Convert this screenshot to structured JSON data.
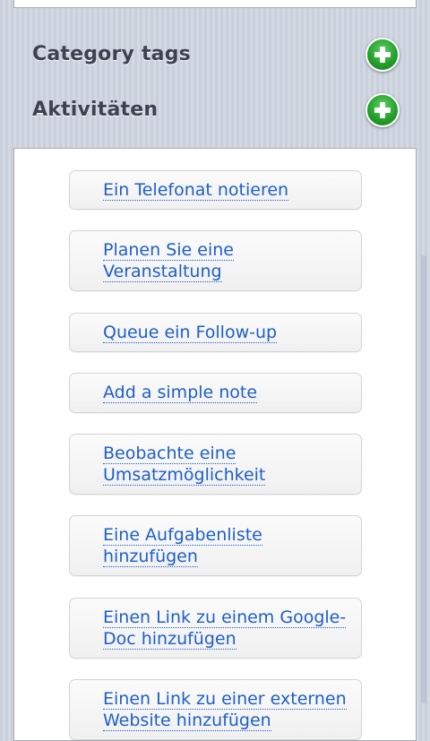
{
  "sections": [
    {
      "title": "Category tags",
      "button": "add"
    },
    {
      "title": "Aktivitäten",
      "button": "add"
    }
  ],
  "activities": [
    "Ein Telefonat notieren",
    "Planen Sie eine Veranstaltung",
    "Queue ein Follow-up",
    "Add a simple note",
    "Beobachte eine Umsatzmöglichkeit",
    "Eine Aufgabenliste hinzufügen",
    "Einen Link zu einem Google-Doc hinzufügen",
    "Einen Link zu einer externen Website hinzufügen"
  ],
  "colors": {
    "link": "#1e5fc9",
    "add_button": "#24a12c",
    "section_title": "#3d4152"
  },
  "icons": {
    "add": "plus-circle-icon"
  }
}
